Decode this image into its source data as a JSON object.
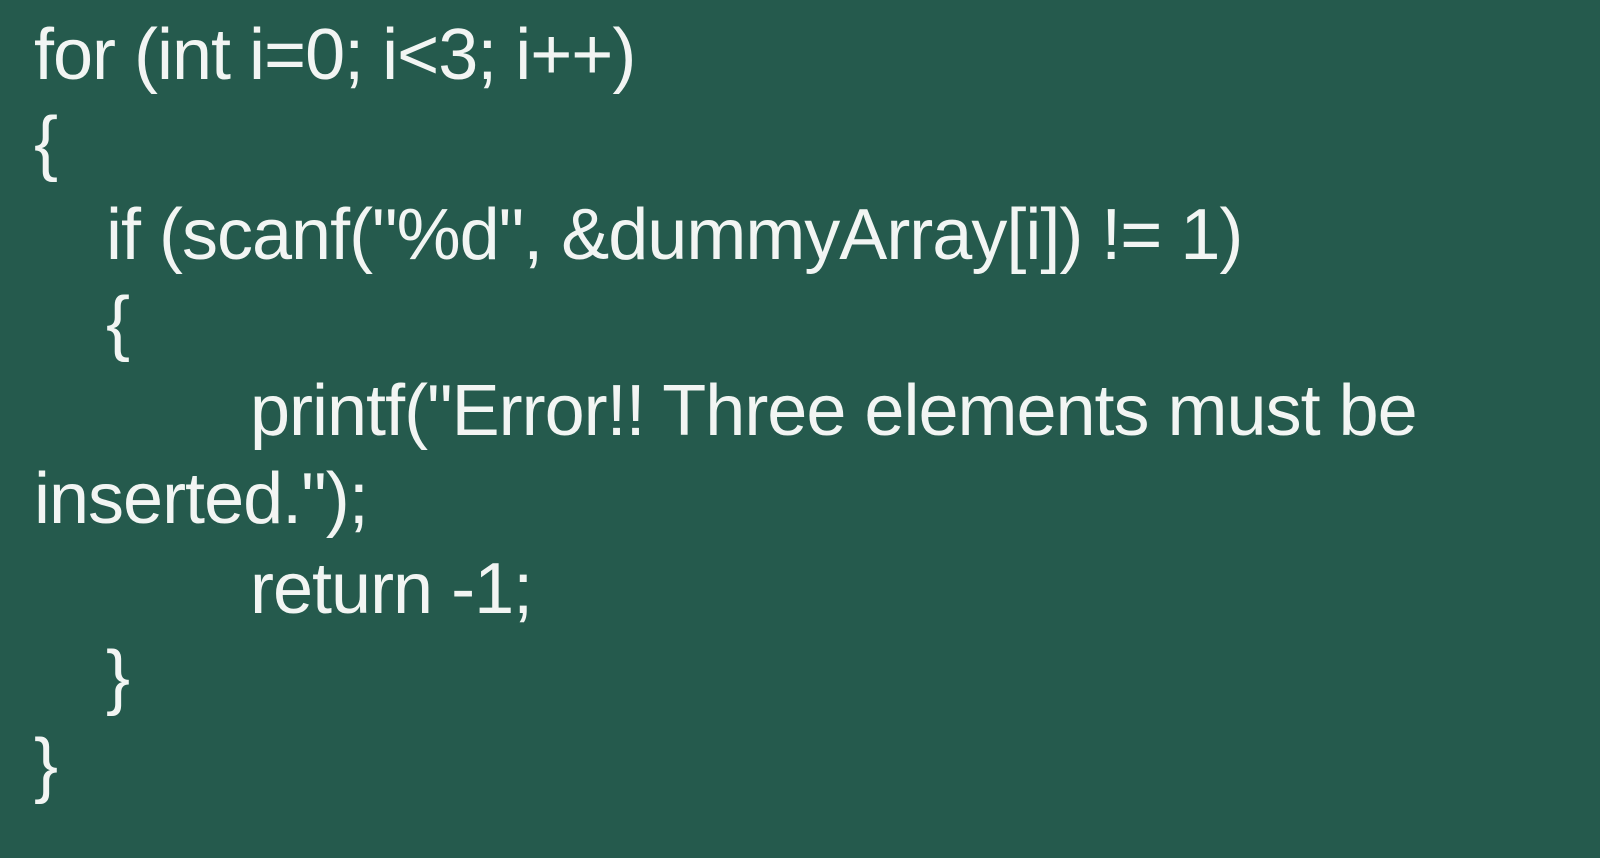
{
  "code": {
    "lines": [
      "for (int i=0; i<3; i++)",
      "{",
      "if (scanf(\"%d\", &dummyArray[i]) != 1)",
      "{",
      "printf(\"Error!! Three elements must be",
      "inserted.\");",
      "return -1;",
      "}",
      "}"
    ]
  },
  "colors": {
    "background": "#255a4d",
    "text": "#f2f5f3"
  }
}
